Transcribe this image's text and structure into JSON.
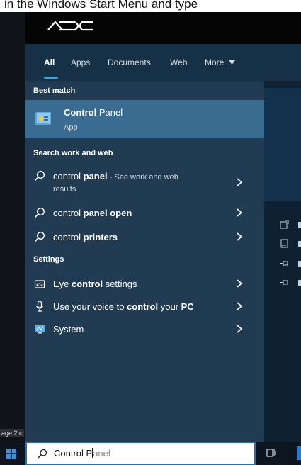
{
  "background": {
    "instruction_text": "in the Windows Start Menu and type",
    "doc_status": "age 2 c"
  },
  "menu": {
    "tabs": [
      {
        "label": "All"
      },
      {
        "label": "Apps"
      },
      {
        "label": "Documents"
      },
      {
        "label": "Web"
      },
      {
        "label": "More"
      }
    ],
    "best_match": {
      "label": "Best match",
      "title_bold": "Control",
      "title_rest": " Panel",
      "subtitle": "App"
    },
    "search_work_web": {
      "label": "Search work and web",
      "items": [
        {
          "pre": "control ",
          "bold": "panel",
          "post": "",
          "hint": " - See work and web",
          "sub": "results"
        },
        {
          "pre": "control ",
          "bold": "panel open",
          "post": ""
        },
        {
          "pre": "control ",
          "bold": "printers",
          "post": ""
        }
      ]
    },
    "settings": {
      "label": "Settings",
      "items": [
        {
          "pre": "Eye ",
          "bold": "control",
          "post": " settings",
          "icon": "eye-icon"
        },
        {
          "pre": "Use your voice to ",
          "bold": "control",
          "post": " your ",
          "bold2": "PC",
          "icon": "microphone-icon"
        },
        {
          "pre": "System",
          "bold": "",
          "post": "",
          "icon": "monitor-icon"
        }
      ]
    }
  },
  "taskbar": {
    "search_value_typed": "Control P",
    "search_value_suggested": "anel",
    "colors": {
      "accent": "#2b6ea6",
      "menu_bg": "#203b52",
      "selected_row": "#3a6c92"
    }
  }
}
